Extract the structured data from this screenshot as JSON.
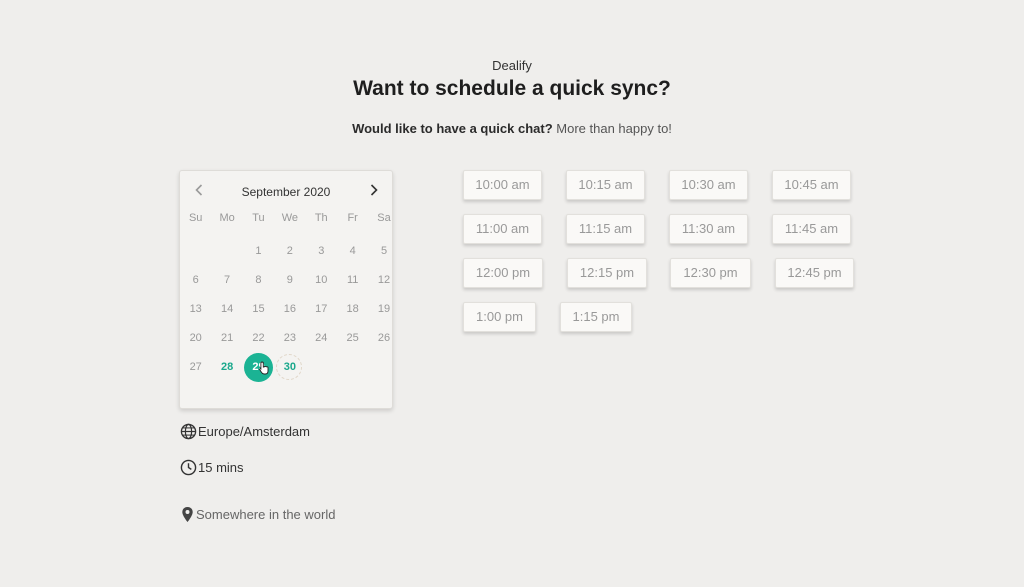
{
  "header": {
    "brand": "Dealify",
    "title": "Want to schedule a quick sync?",
    "subtitle_bold": "Would like to have a quick chat?",
    "subtitle_rest": "More than happy to!"
  },
  "calendar": {
    "month_label": "September 2020",
    "prev_icon": "chevron-left-icon",
    "next_icon": "chevron-right-icon",
    "weekdays": [
      "Su",
      "Mo",
      "Tu",
      "We",
      "Th",
      "Fr",
      "Sa"
    ],
    "weeks": [
      [
        "",
        "",
        "1",
        "2",
        "3",
        "4",
        "5"
      ],
      [
        "6",
        "7",
        "8",
        "9",
        "10",
        "11",
        "12"
      ],
      [
        "13",
        "14",
        "15",
        "16",
        "17",
        "18",
        "19"
      ],
      [
        "20",
        "21",
        "22",
        "23",
        "24",
        "25",
        "26"
      ],
      [
        "27",
        "28",
        "29",
        "30",
        "",
        "",
        ""
      ]
    ],
    "available_days": [
      "28",
      "29",
      "30"
    ],
    "selected_day": "29",
    "accent_color": "#1bb394"
  },
  "details": {
    "timezone": "Europe/Amsterdam",
    "timezone_icon": "globe-icon",
    "duration": "15 mins",
    "duration_icon": "clock-icon",
    "location": "Somewhere in the world",
    "location_icon": "map-pin-icon"
  },
  "slots": [
    "10:00 am",
    "10:15 am",
    "10:30 am",
    "10:45 am",
    "11:00 am",
    "11:15 am",
    "11:30 am",
    "11:45 am",
    "12:00 pm",
    "12:15 pm",
    "12:30 pm",
    "12:45 pm",
    "1:00 pm",
    "1:15 pm"
  ]
}
